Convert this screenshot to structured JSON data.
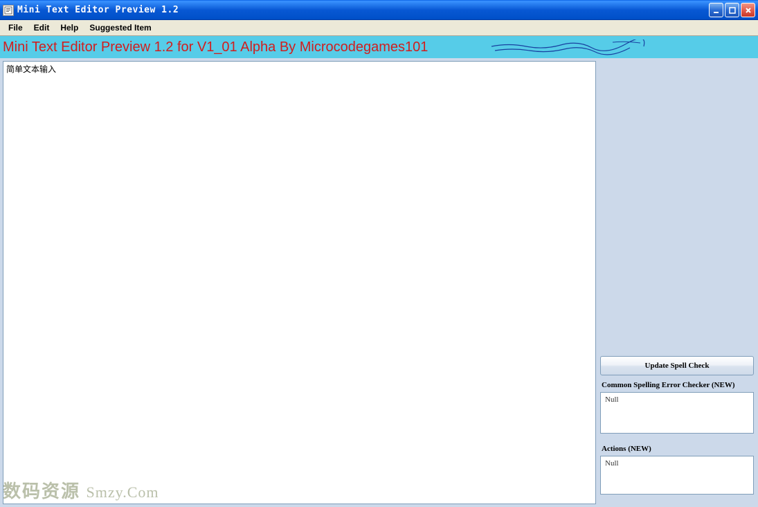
{
  "window": {
    "title": "Mini Text Editor Preview 1.2"
  },
  "menu": {
    "items": [
      "File",
      "Edit",
      "Help",
      "Suggested Item"
    ]
  },
  "banner": {
    "text": "Mini Text Editor Preview 1.2 for V1_01 Alpha By Microcodegames101"
  },
  "editor": {
    "content": "简单文本输入"
  },
  "sidebar": {
    "spell_check_button": "Update Spell Check",
    "spell_check_label": "Common Spelling Error Checker (NEW)",
    "spell_check_value": "Null",
    "actions_label": "Actions (NEW)",
    "actions_value": "Null"
  },
  "watermark": {
    "cn": "数码资源",
    "en": "Smzy.Com"
  }
}
